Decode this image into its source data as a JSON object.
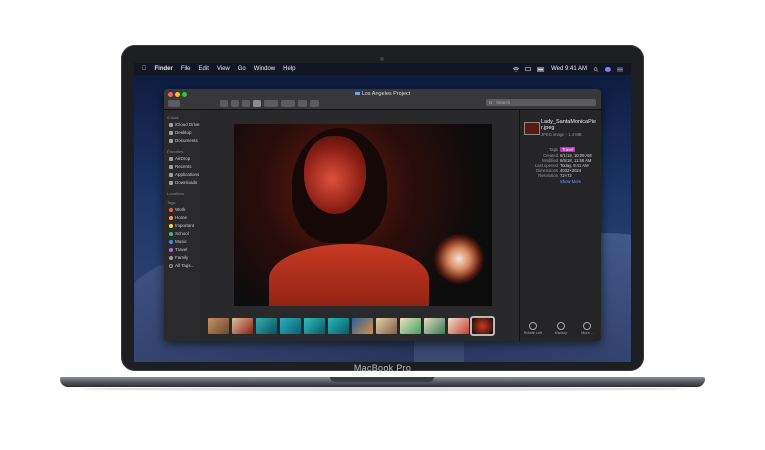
{
  "device": {
    "label": "MacBook Pro"
  },
  "menubar": {
    "app_name": "Finder",
    "items": [
      "File",
      "Edit",
      "View",
      "Go",
      "Window",
      "Help"
    ],
    "clock": "Wed 9:41 AM"
  },
  "window": {
    "title": "Los Angeles Project",
    "search_placeholder": "Search"
  },
  "sidebar": {
    "icloud": {
      "header": "iCloud",
      "items": [
        "iCloud Drive",
        "Desktop",
        "Documents"
      ]
    },
    "favorites": {
      "header": "Favorites",
      "items": [
        "AirDrop",
        "Recents",
        "Applications",
        "Downloads"
      ]
    },
    "locations": {
      "header": "Locations"
    },
    "tags": {
      "header": "Tags",
      "items": [
        {
          "label": "Work",
          "color": "#ff5a4f"
        },
        {
          "label": "Home",
          "color": "#ff9f2e"
        },
        {
          "label": "Important",
          "color": "#ffd43b"
        },
        {
          "label": "School",
          "color": "#40c463"
        },
        {
          "label": "Music",
          "color": "#3d8bff"
        },
        {
          "label": "Travel",
          "color": "#c061e8"
        },
        {
          "label": "Family",
          "color": "#9a9aa0"
        },
        {
          "label": "All Tags..."
        }
      ]
    }
  },
  "inspector": {
    "file_name": "Lady_SantaMonicaPier.jpeg",
    "kind": "JPEG image - 1.4 MB",
    "tags_label": "Tags",
    "tag_value": "Travel",
    "rows": [
      {
        "k": "Created",
        "v": "6/1/18, 10:09 AM"
      },
      {
        "k": "Modified",
        "v": "6/5/18, 11:58 AM"
      },
      {
        "k": "Last opened",
        "v": "Today, 9:41 AM"
      },
      {
        "k": "Dimensions",
        "v": "4032×3024"
      },
      {
        "k": "Resolution",
        "v": "72×72"
      }
    ],
    "show_more": "Show More",
    "actions": [
      "Rotate Left",
      "Markup",
      "More..."
    ]
  },
  "colors": {
    "accent": "#6ea2ff",
    "travel_tag": "#c22ac2"
  }
}
